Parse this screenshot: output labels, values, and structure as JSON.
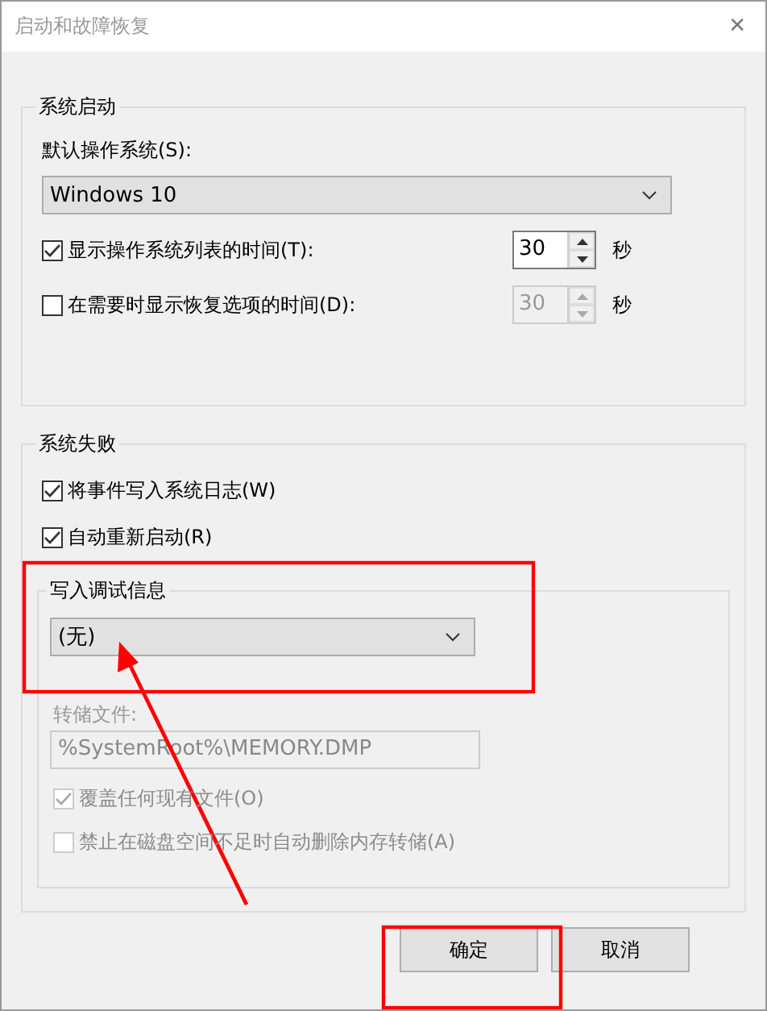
{
  "window": {
    "title": "启动和故障恢复",
    "close": "✕"
  },
  "startup": {
    "legend": "系统启动",
    "default_os_label": "默认操作系统(S):",
    "default_os": "Windows 10",
    "rows": [
      {
        "label": "显示操作系统列表的时间(T):",
        "checked": true,
        "value": "30",
        "unit": "秒",
        "disabled": false
      },
      {
        "label": "在需要时显示恢复选项的时间(D):",
        "checked": false,
        "value": "30",
        "unit": "秒",
        "disabled": true
      }
    ]
  },
  "failure": {
    "legend": "系统失败",
    "checks": [
      {
        "label": "将事件写入系统日志(W)",
        "checked": true,
        "disabled": false
      },
      {
        "label": "自动重新启动(R)",
        "checked": true,
        "disabled": false
      }
    ],
    "debug": {
      "legend": "写入调试信息",
      "value": "(无)",
      "dump_label": "转储文件:",
      "dump_file": "%SystemRoot%\\MEMORY.DMP",
      "disabled": true,
      "checks": [
        {
          "label": "覆盖任何现有文件(O)",
          "checked": true,
          "disabled": true
        },
        {
          "label": "禁止在磁盘空间不足时自动删除内存转储(A)",
          "checked": false,
          "disabled": true
        }
      ]
    }
  },
  "buttons": [
    {
      "label": "确定"
    },
    {
      "label": "取消"
    }
  ]
}
